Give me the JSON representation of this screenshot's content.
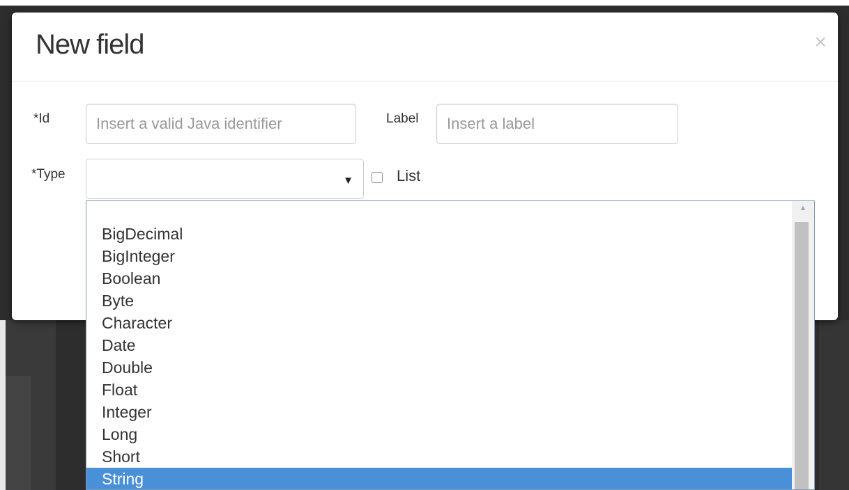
{
  "modal": {
    "title": "New field",
    "close_symbol": "×"
  },
  "form": {
    "id_label": "*Id",
    "id_placeholder": "Insert a valid Java identifier",
    "label_label": "Label",
    "label_placeholder": "Insert a label",
    "type_label": "*Type",
    "type_value": "",
    "list_label": "List",
    "list_checked": false
  },
  "dropdown": {
    "options": [
      "BigDecimal",
      "BigInteger",
      "Boolean",
      "Byte",
      "Character",
      "Date",
      "Double",
      "Float",
      "Integer",
      "Long",
      "Short",
      "String"
    ],
    "selected": "String"
  },
  "icons": {
    "close": "close-icon",
    "select_arrow": "chevron-down-icon",
    "scroll_up": "scroll-up-arrow-icon"
  },
  "colors": {
    "selected_option": "#4a90d9",
    "dropdown_border": "#7f9db9"
  }
}
